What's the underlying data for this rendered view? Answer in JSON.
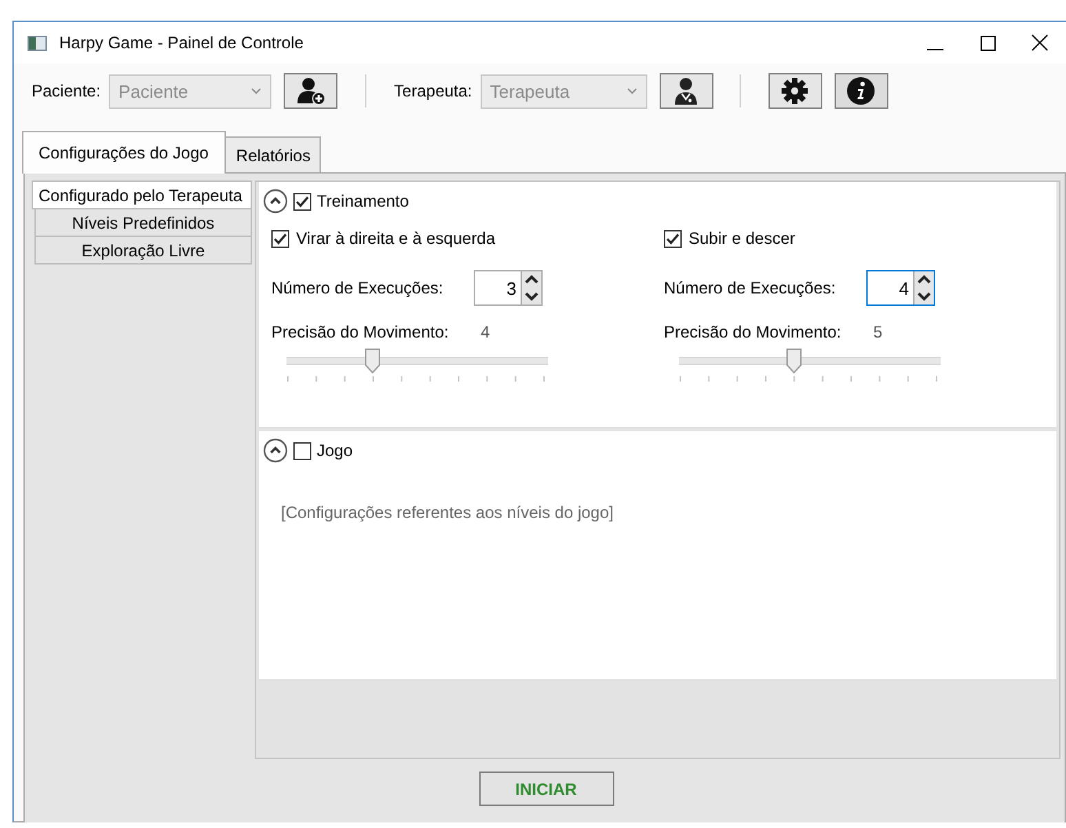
{
  "window": {
    "title": "Harpy Game - Painel de Controle"
  },
  "toolbar": {
    "patient": {
      "label": "Paciente:",
      "placeholder": "Paciente"
    },
    "therapist": {
      "label": "Terapeuta:",
      "placeholder": "Terapeuta"
    }
  },
  "tabs": [
    {
      "label": "Configurações do Jogo",
      "selected": true
    },
    {
      "label": "Relatórios",
      "selected": false
    }
  ],
  "modes": [
    {
      "label": "Configurado pelo Terapeuta",
      "selected": true
    },
    {
      "label": "Níveis Predefinidos",
      "selected": false
    },
    {
      "label": "Exploração Livre",
      "selected": false
    }
  ],
  "groups": [
    {
      "kind": "exercises",
      "title": "Treinamento",
      "checked": true,
      "expanded": true,
      "exercises": [
        {
          "label": "Virar à direita e à esquerda",
          "checked": true,
          "runs_label": "Número de Execuções:",
          "runs": "3",
          "focused": false,
          "precision_label": "Precisão do Movimento:",
          "precision": "4",
          "level": 0.333
        },
        {
          "label": "Subir e descer",
          "checked": true,
          "runs_label": "Número de Execuções:",
          "runs": "4",
          "focused": true,
          "precision_label": "Precisão do Movimento:",
          "precision": "5",
          "level": 0.444
        }
      ]
    },
    {
      "kind": "note",
      "title": "Jogo",
      "checked": false,
      "expanded": true,
      "note": "[Configurações referentes aos níveis do jogo]"
    }
  ],
  "start_button": "INICIAR"
}
